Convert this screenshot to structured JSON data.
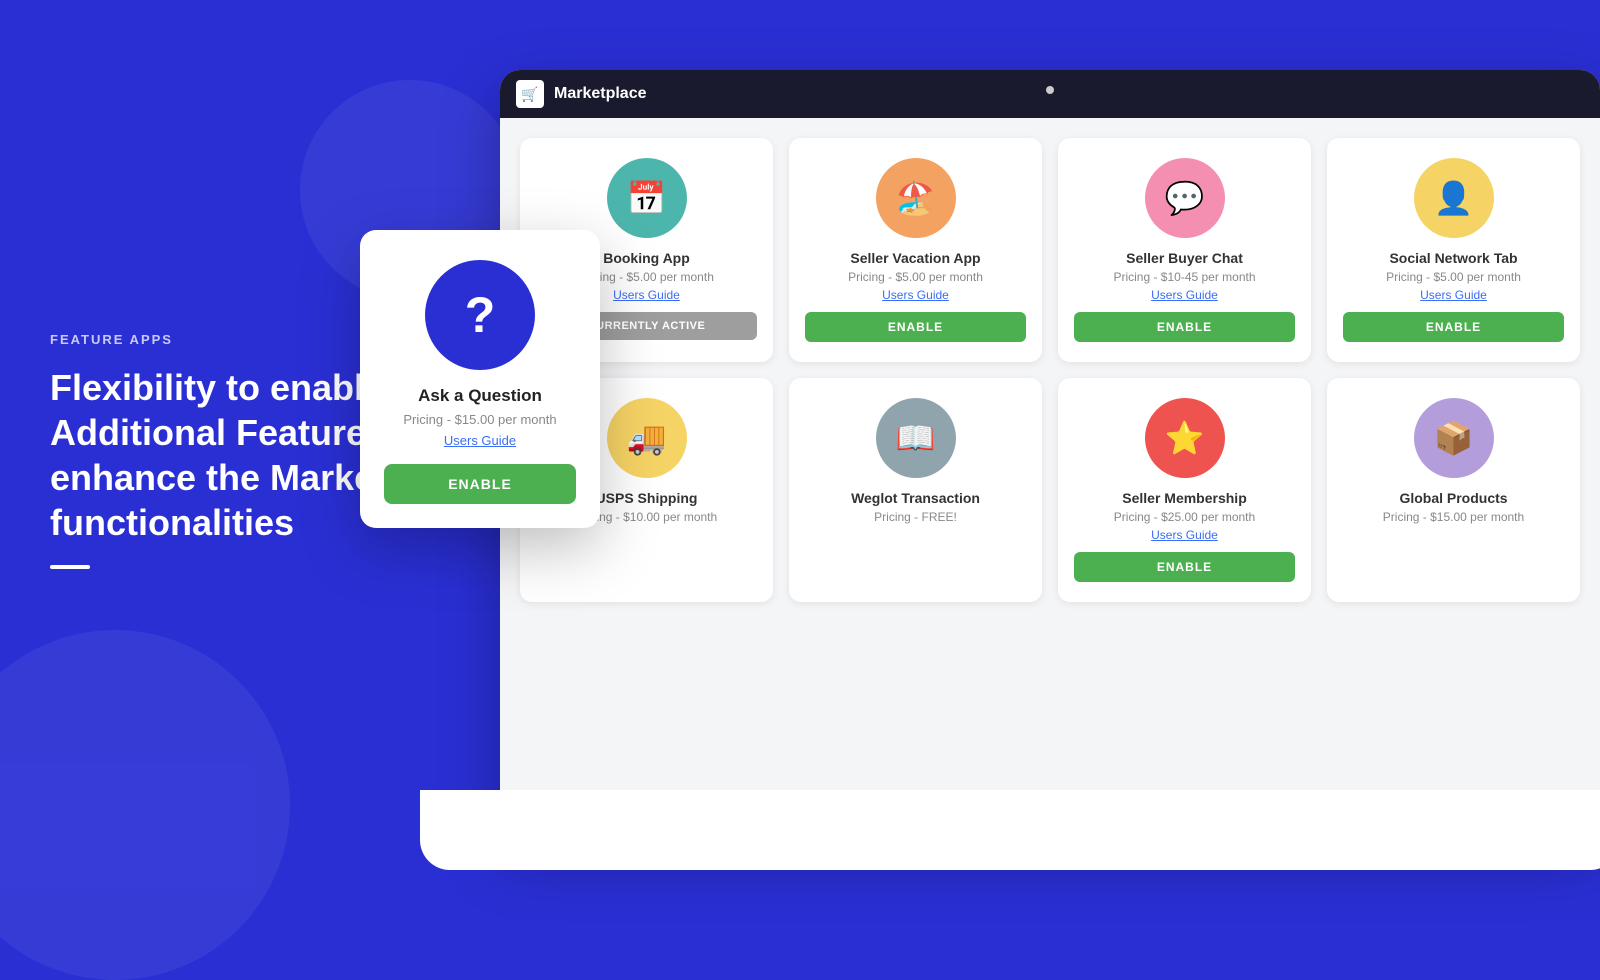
{
  "left": {
    "feature_label": "FEATURE APPS",
    "heading": "Flexibility to enable Additional Features to enhance the Marketplace functionalities"
  },
  "marketplace": {
    "title": "Marketplace",
    "icon": "🛒"
  },
  "popup": {
    "name": "Ask a Question",
    "pricing": "Pricing - $15.00 per month",
    "guide": "Users Guide",
    "enable_btn": "ENABLE"
  },
  "row1_cards": [
    {
      "name": "Booking App",
      "pricing": "Pricing - $5.00 per month",
      "guide": "Users Guide",
      "btn": "CURRENTLY ACTIVE",
      "btn_type": "active",
      "icon": "📅",
      "icon_color": "teal"
    },
    {
      "name": "Seller Vacation App",
      "pricing": "Pricing - $5.00 per month",
      "guide": "Users Guide",
      "btn": "ENABLE",
      "btn_type": "enable",
      "icon": "🏖️",
      "icon_color": "orange"
    },
    {
      "name": "Seller Buyer Chat",
      "pricing": "Pricing - $10-45 per month",
      "guide": "Users Guide",
      "btn": "ENABLE",
      "btn_type": "enable",
      "icon": "💬",
      "icon_color": "pink"
    },
    {
      "name": "Social Network Tab",
      "pricing": "Pricing - $5.00 per month",
      "guide": "Users Guide",
      "btn": "ENABLE",
      "btn_type": "enable",
      "icon": "👤",
      "icon_color": "yellow"
    }
  ],
  "row2_cards": [
    {
      "name": "USPS Shipping",
      "pricing": "Pricing - $10.00 per month",
      "guide": "",
      "btn": "",
      "btn_type": "none",
      "icon": "🚚",
      "icon_color": "yellow"
    },
    {
      "name": "Weglot Transaction",
      "pricing": "Pricing - FREE!",
      "guide": "",
      "btn": "",
      "btn_type": "none",
      "icon": "📖",
      "icon_color": "slate"
    },
    {
      "name": "Seller Membership",
      "pricing": "Pricing - $25.00 per month",
      "guide": "Users Guide",
      "btn": "ENABLE",
      "btn_type": "enable",
      "icon": "⭐",
      "icon_color": "red"
    },
    {
      "name": "Global Products",
      "pricing": "Pricing - $15.00 per month",
      "guide": "",
      "btn": "",
      "btn_type": "none",
      "icon": "📦",
      "icon_color": "lavender"
    }
  ]
}
